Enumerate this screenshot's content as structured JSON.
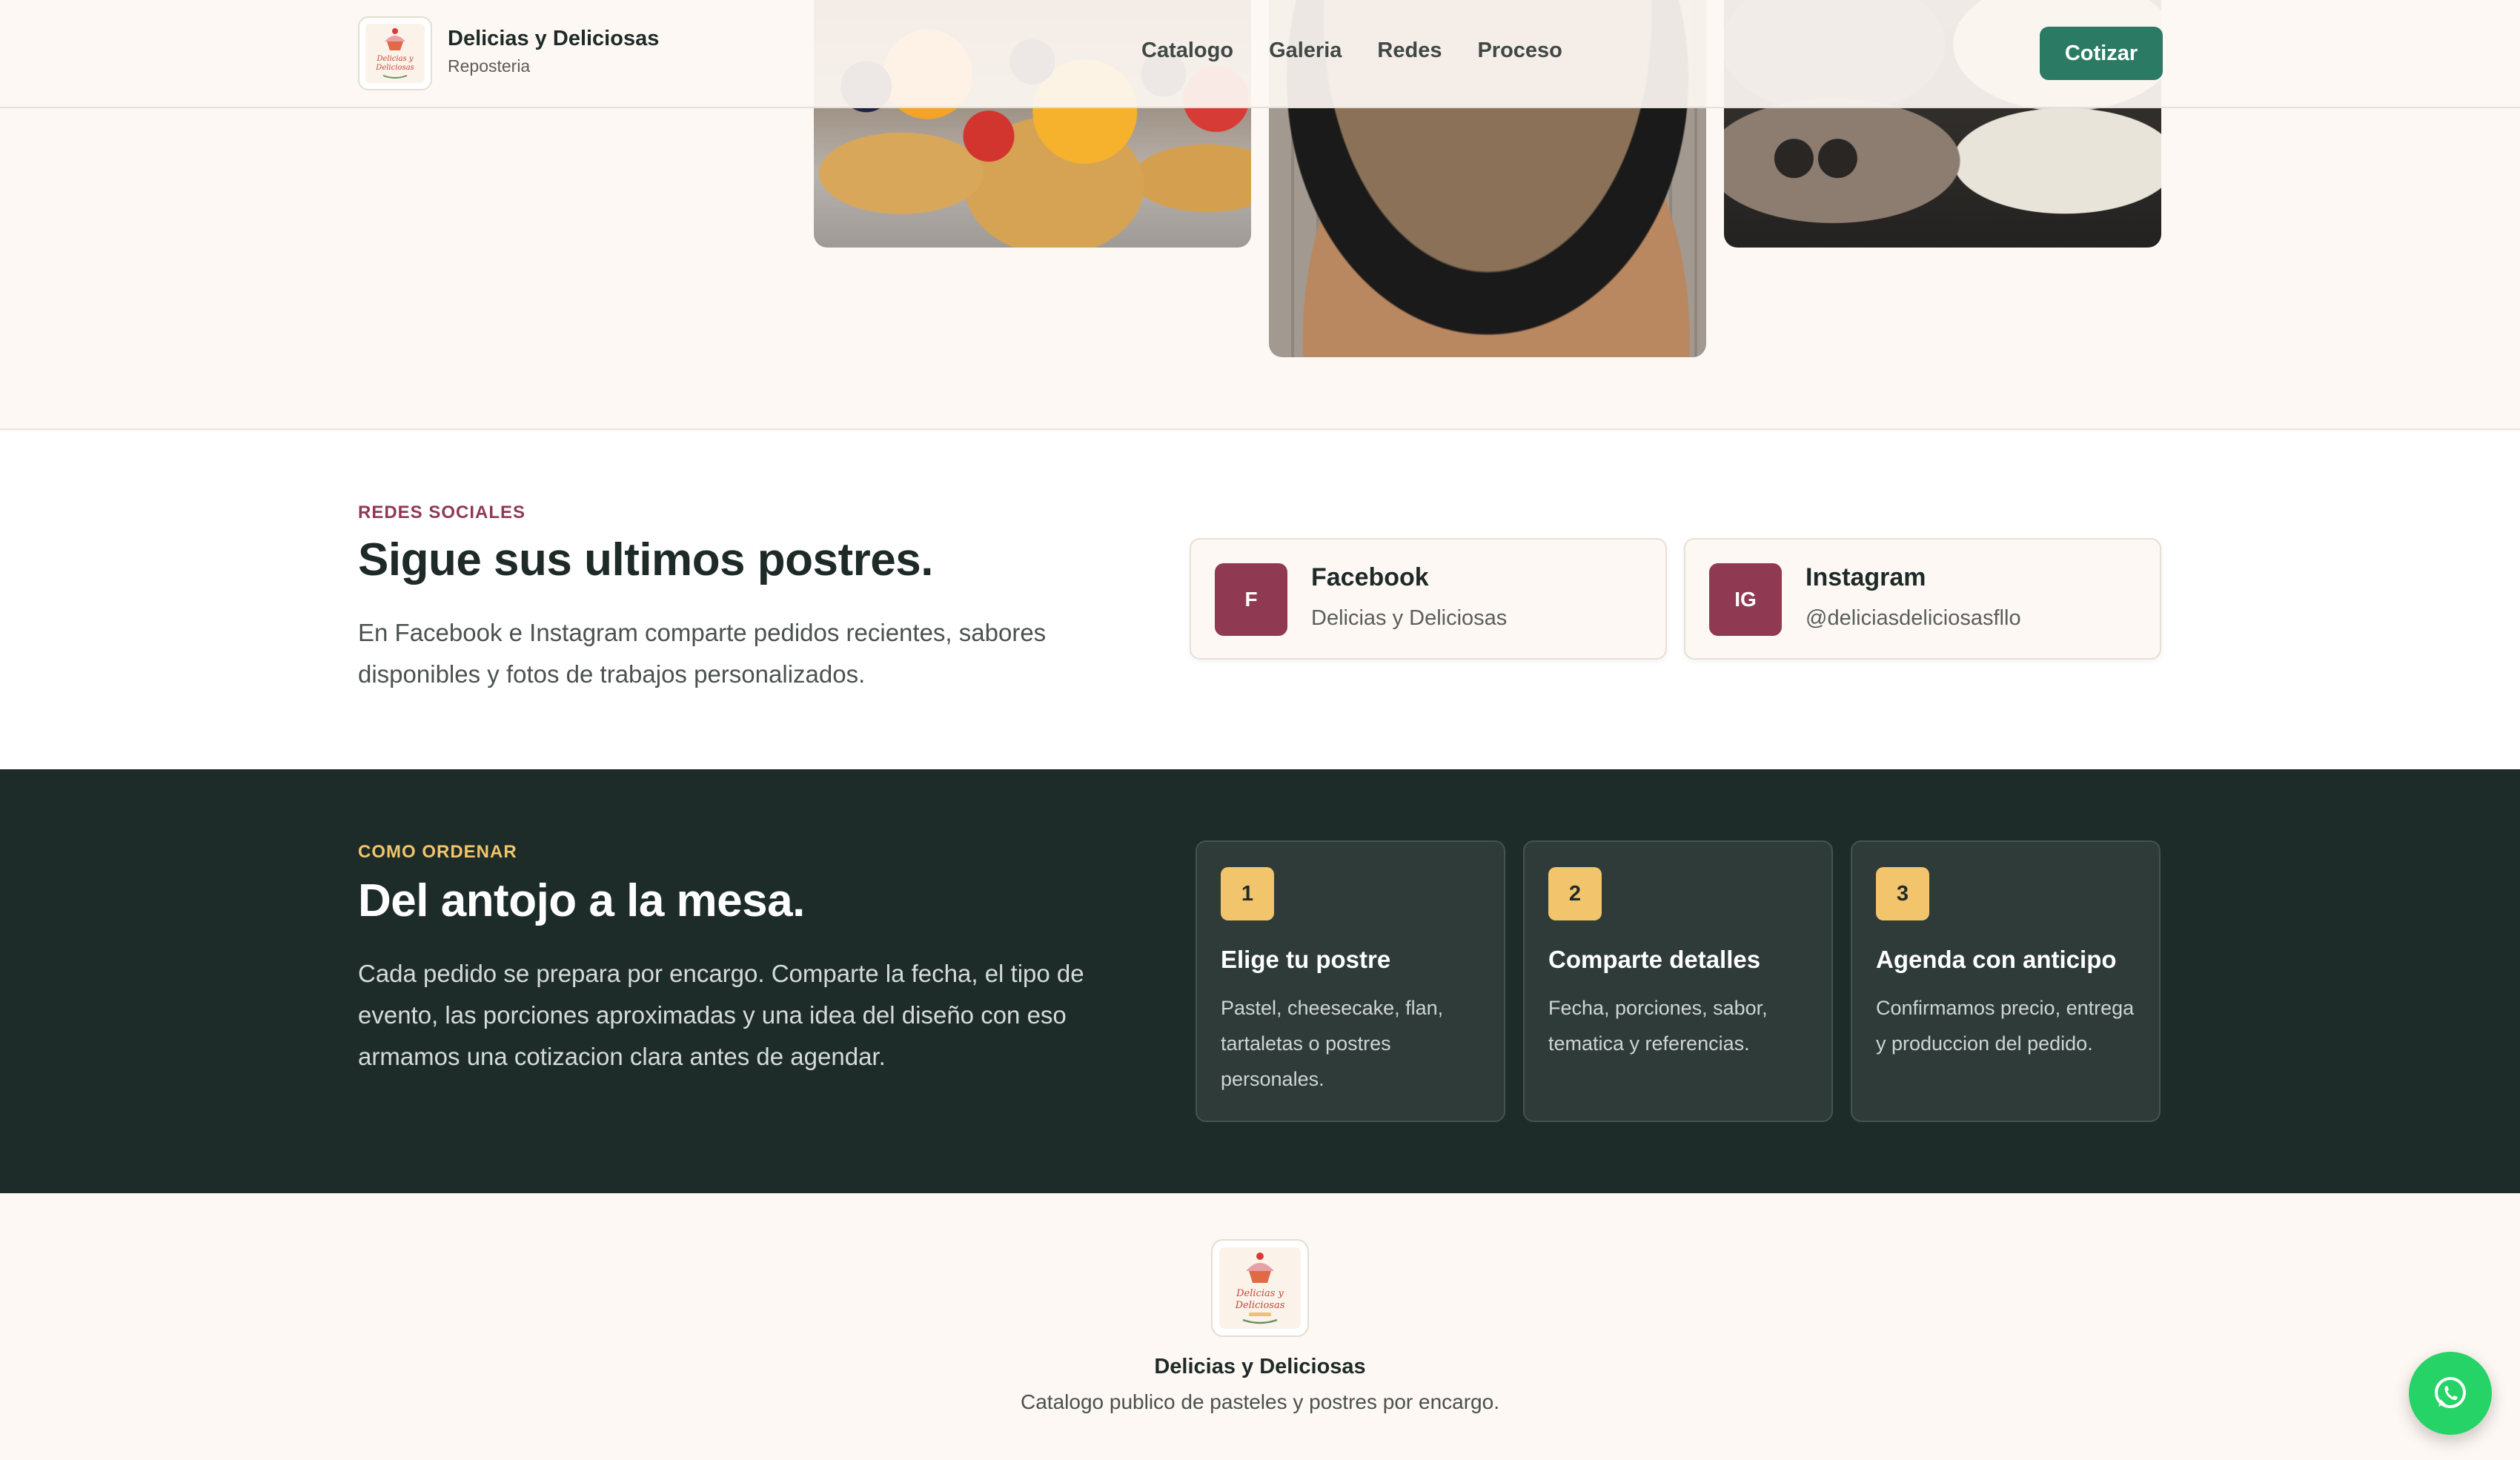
{
  "header": {
    "brand_name": "Delicias y Deliciosas",
    "brand_sub": "Reposteria",
    "nav": [
      "Catalogo",
      "Galeria",
      "Redes",
      "Proceso"
    ],
    "cta_label": "Cotizar"
  },
  "logo": {
    "line1": "Delicias y",
    "line2": "Deliciosas"
  },
  "social": {
    "eyebrow": "REDES SOCIALES",
    "title": "Sigue sus ultimos postres.",
    "text": "En Facebook e Instagram comparte pedidos recientes, sabores disponibles y fotos de trabajos personalizados.",
    "cards": [
      {
        "badge": "F",
        "name": "Facebook",
        "handle": "Delicias y Deliciosas",
        "icon": "facebook-icon"
      },
      {
        "badge": "IG",
        "name": "Instagram",
        "handle": "@deliciasdeliciosasfllo",
        "icon": "instagram-icon"
      }
    ]
  },
  "order": {
    "eyebrow": "COMO ORDENAR",
    "title": "Del antojo a la mesa.",
    "text": "Cada pedido se prepara por encargo. Comparte la fecha, el tipo de evento, las porciones aproximadas y una idea del diseño con eso armamos una cotizacion clara antes de agendar.",
    "steps": [
      {
        "number": "1",
        "title": "Elige tu postre",
        "desc": "Pastel, cheesecake, flan, tartaletas o postres personales."
      },
      {
        "number": "2",
        "title": "Comparte detalles",
        "desc": "Fecha, porciones, sabor, tematica y referencias."
      },
      {
        "number": "3",
        "title": "Agenda con anticipo",
        "desc": "Confirmamos precio, entrega y produccion del pedido."
      }
    ]
  },
  "footer": {
    "name": "Delicias y Deliciosas",
    "tagline": "Catalogo publico de pasteles y postres por encargo."
  },
  "floating": {
    "icon": "whatsapp-icon"
  },
  "colors": {
    "accent_green": "#2b7a63",
    "brand_wine": "#8f3a52",
    "dark_section": "#1d2c29",
    "step_gold": "#f2c46b",
    "page_cream": "#fdf8f3",
    "whatsapp_green": "#25d366"
  }
}
